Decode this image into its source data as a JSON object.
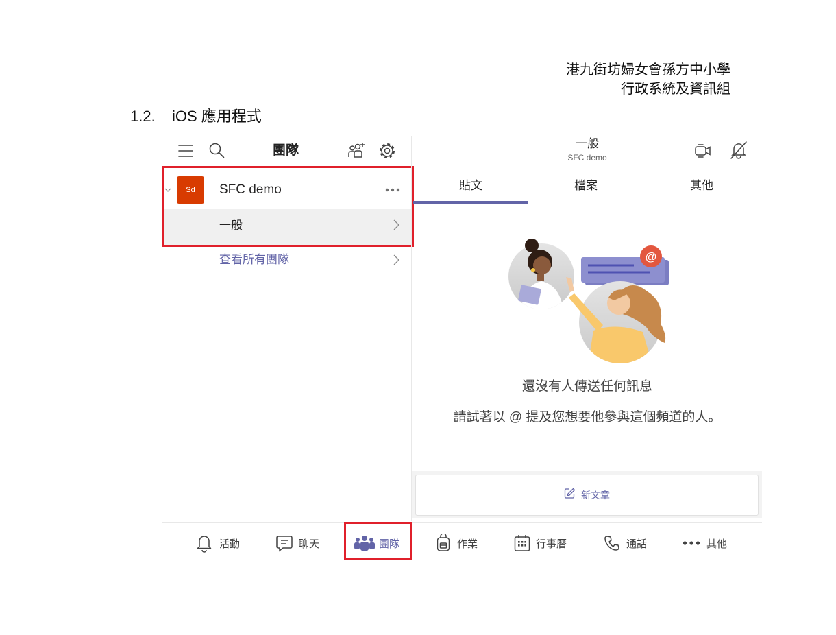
{
  "document": {
    "header_line1": "港九街坊婦女會孫方中小學",
    "header_line2": "行政系統及資訊組",
    "section_number": "1.2.",
    "section_title": "iOS 應用程式"
  },
  "left_panel": {
    "title": "團隊",
    "toolbar_icons": [
      "hamburger-menu-icon",
      "search-icon",
      "add-people-icon",
      "gear-icon"
    ],
    "team": {
      "avatar_initials": "Sd",
      "name": "SFC demo",
      "expanded": true
    },
    "channel": {
      "name": "一般"
    },
    "see_all": "查看所有團隊"
  },
  "channel_view": {
    "title": "一般",
    "subtitle": "SFC demo",
    "header_icons": [
      "video-call-icon",
      "bell-off-icon"
    ],
    "tabs": [
      {
        "label": "貼文",
        "active": true
      },
      {
        "label": "檔案",
        "active": false
      },
      {
        "label": "其他",
        "active": false
      }
    ],
    "mention_badge": "@",
    "empty_title": "還沒有人傳送任何訊息",
    "empty_hint": "請試著以 @ 提及您想要他參與這個頻道的人。",
    "new_post": "新文章"
  },
  "bottom_nav": {
    "items": [
      {
        "label": "活動",
        "icon": "bell-icon",
        "active": false
      },
      {
        "label": "聊天",
        "icon": "chat-icon",
        "active": false
      },
      {
        "label": "團隊",
        "icon": "teams-icon",
        "active": true
      },
      {
        "label": "作業",
        "icon": "backpack-icon",
        "active": false
      },
      {
        "label": "行事曆",
        "icon": "calendar-icon",
        "active": false
      },
      {
        "label": "通話",
        "icon": "phone-icon",
        "active": false
      },
      {
        "label": "其他",
        "icon": "more-icon",
        "active": false
      }
    ]
  },
  "colors": {
    "accent": "#6264a7",
    "highlight": "#e0202b",
    "avatar": "#d83b01"
  }
}
